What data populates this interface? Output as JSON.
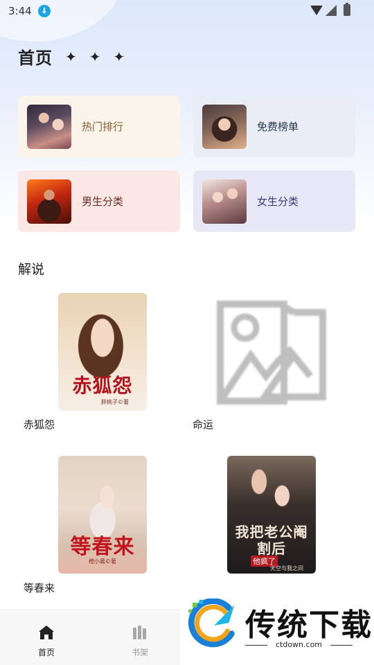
{
  "status_bar": {
    "time": "3:44"
  },
  "header": {
    "title": "首页",
    "sparkles": [
      "✦",
      "✦",
      "✦"
    ]
  },
  "categories": [
    {
      "label": "热门排行",
      "bg": "#faf4eb",
      "color": "#8a6030"
    },
    {
      "label": "免费榜单",
      "bg": "#e9eef6",
      "color": "#2a3450"
    },
    {
      "label": "男生分类",
      "bg": "#fbe8e6",
      "color": "#6a2a22"
    },
    {
      "label": "女生分类",
      "bg": "#e7e7f5",
      "color": "#3d3c7a"
    }
  ],
  "section": {
    "title": "解说"
  },
  "books": [
    {
      "title": "赤狐怨",
      "cover_title": "赤狐怨",
      "cover_author": "胖桃子©著"
    },
    {
      "title": "命运"
    },
    {
      "title": "等春来",
      "cover_title": "等春来",
      "cover_author": "橙小晨©著"
    },
    {
      "title": "",
      "cover_title": "我把老公阉割后",
      "cover_tag": "他疯了",
      "cover_author": "天空与我之间"
    }
  ],
  "bottom_nav": [
    {
      "label": "首页",
      "active": true,
      "icon": "home-icon"
    },
    {
      "label": "书架",
      "active": false,
      "icon": "bookshelf-icon"
    }
  ],
  "watermark": {
    "brand": "传统下载",
    "url": "ctdown.com"
  }
}
